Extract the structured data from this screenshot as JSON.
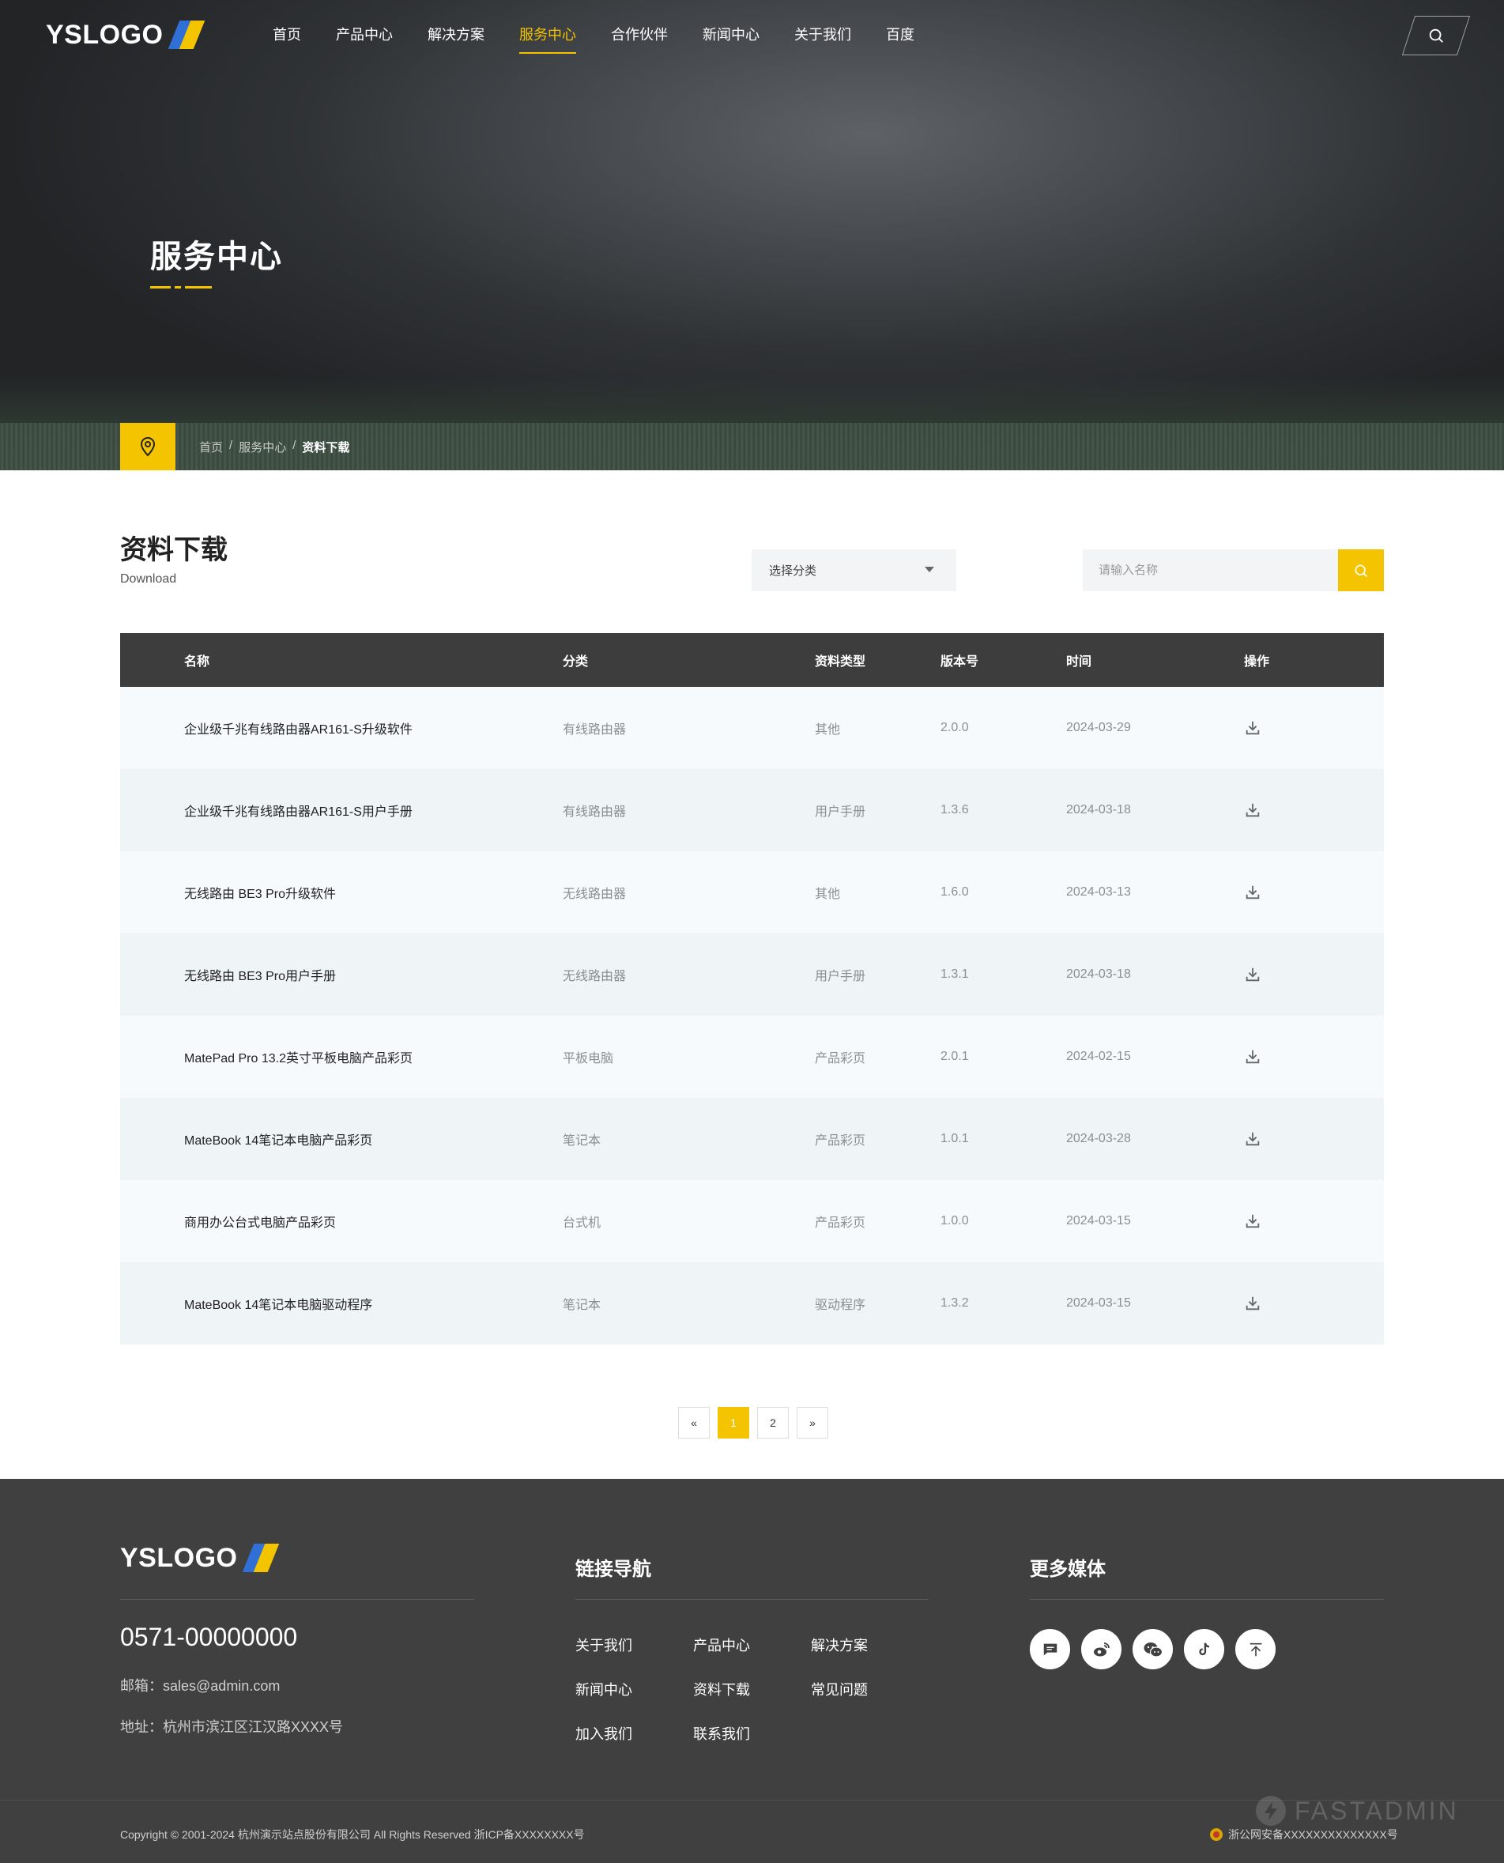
{
  "brand": {
    "logo_text": "YSLOGO"
  },
  "nav": {
    "items": [
      {
        "label": "首页"
      },
      {
        "label": "产品中心"
      },
      {
        "label": "解决方案"
      },
      {
        "label": "服务中心"
      },
      {
        "label": "合作伙伴"
      },
      {
        "label": "新闻中心"
      },
      {
        "label": "关于我们"
      },
      {
        "label": "百度"
      }
    ],
    "active_label": "服务中心"
  },
  "hero": {
    "title": "服务中心"
  },
  "breadcrumb": {
    "items": [
      "首页",
      "服务中心"
    ],
    "separator": "/",
    "current": "资料下载"
  },
  "section": {
    "title": "资料下载",
    "subtitle": "Download"
  },
  "filter": {
    "select_label": "选择分类",
    "search_placeholder": "请输入名称"
  },
  "table": {
    "headers": {
      "name": "名称",
      "category": "分类",
      "type": "资料类型",
      "version": "版本号",
      "time": "时间",
      "action": "操作"
    },
    "rows": [
      {
        "name": "企业级千兆有线路由器AR161-S升级软件",
        "category": "有线路由器",
        "type": "其他",
        "version": "2.0.0",
        "time": "2024-03-29"
      },
      {
        "name": "企业级千兆有线路由器AR161-S用户手册",
        "category": "有线路由器",
        "type": "用户手册",
        "version": "1.3.6",
        "time": "2024-03-18"
      },
      {
        "name": "无线路由 BE3 Pro升级软件",
        "category": "无线路由器",
        "type": "其他",
        "version": "1.6.0",
        "time": "2024-03-13"
      },
      {
        "name": "无线路由 BE3 Pro用户手册",
        "category": "无线路由器",
        "type": "用户手册",
        "version": "1.3.1",
        "time": "2024-03-18"
      },
      {
        "name": "MatePad Pro 13.2英寸平板电脑产品彩页",
        "category": "平板电脑",
        "type": "产品彩页",
        "version": "2.0.1",
        "time": "2024-02-15"
      },
      {
        "name": "MateBook 14笔记本电脑产品彩页",
        "category": "笔记本",
        "type": "产品彩页",
        "version": "1.0.1",
        "time": "2024-03-28"
      },
      {
        "name": "商用办公台式电脑产品彩页",
        "category": "台式机",
        "type": "产品彩页",
        "version": "1.0.0",
        "time": "2024-03-15"
      },
      {
        "name": "MateBook 14笔记本电脑驱动程序",
        "category": "笔记本",
        "type": "驱动程序",
        "version": "1.3.2",
        "time": "2024-03-15"
      }
    ]
  },
  "pagination": {
    "prev": "«",
    "pages": [
      "1",
      "2"
    ],
    "current": "1",
    "next": "»"
  },
  "footer": {
    "logo_text": "YSLOGO",
    "phone": "0571-00000000",
    "email": "邮箱：sales@admin.com",
    "address": "地址：杭州市滨江区江汉路XXXX号",
    "links_heading": "链接导航",
    "links": [
      "关于我们",
      "产品中心",
      "解决方案",
      "新闻中心",
      "资料下载",
      "常见问题",
      "加入我们",
      "联系我们"
    ],
    "media_heading": "更多媒体",
    "media_icons": [
      "message-icon",
      "weibo-icon",
      "wechat-icon",
      "tiktok-icon",
      "back-to-top-icon"
    ],
    "copyright": "Copyright © 2001-2024 杭州演示站点股份有限公司 All Rights Reserved 浙ICP备XXXXXXXX号",
    "police": "浙公网安备XXXXXXXXXXXXXX号",
    "watermark": "FASTADMIN"
  },
  "colors": {
    "accent": "#f5c400",
    "header_dark": "#3d3d3d",
    "footer_bg": "#404040",
    "logo_blue": "#2f6fd6"
  }
}
